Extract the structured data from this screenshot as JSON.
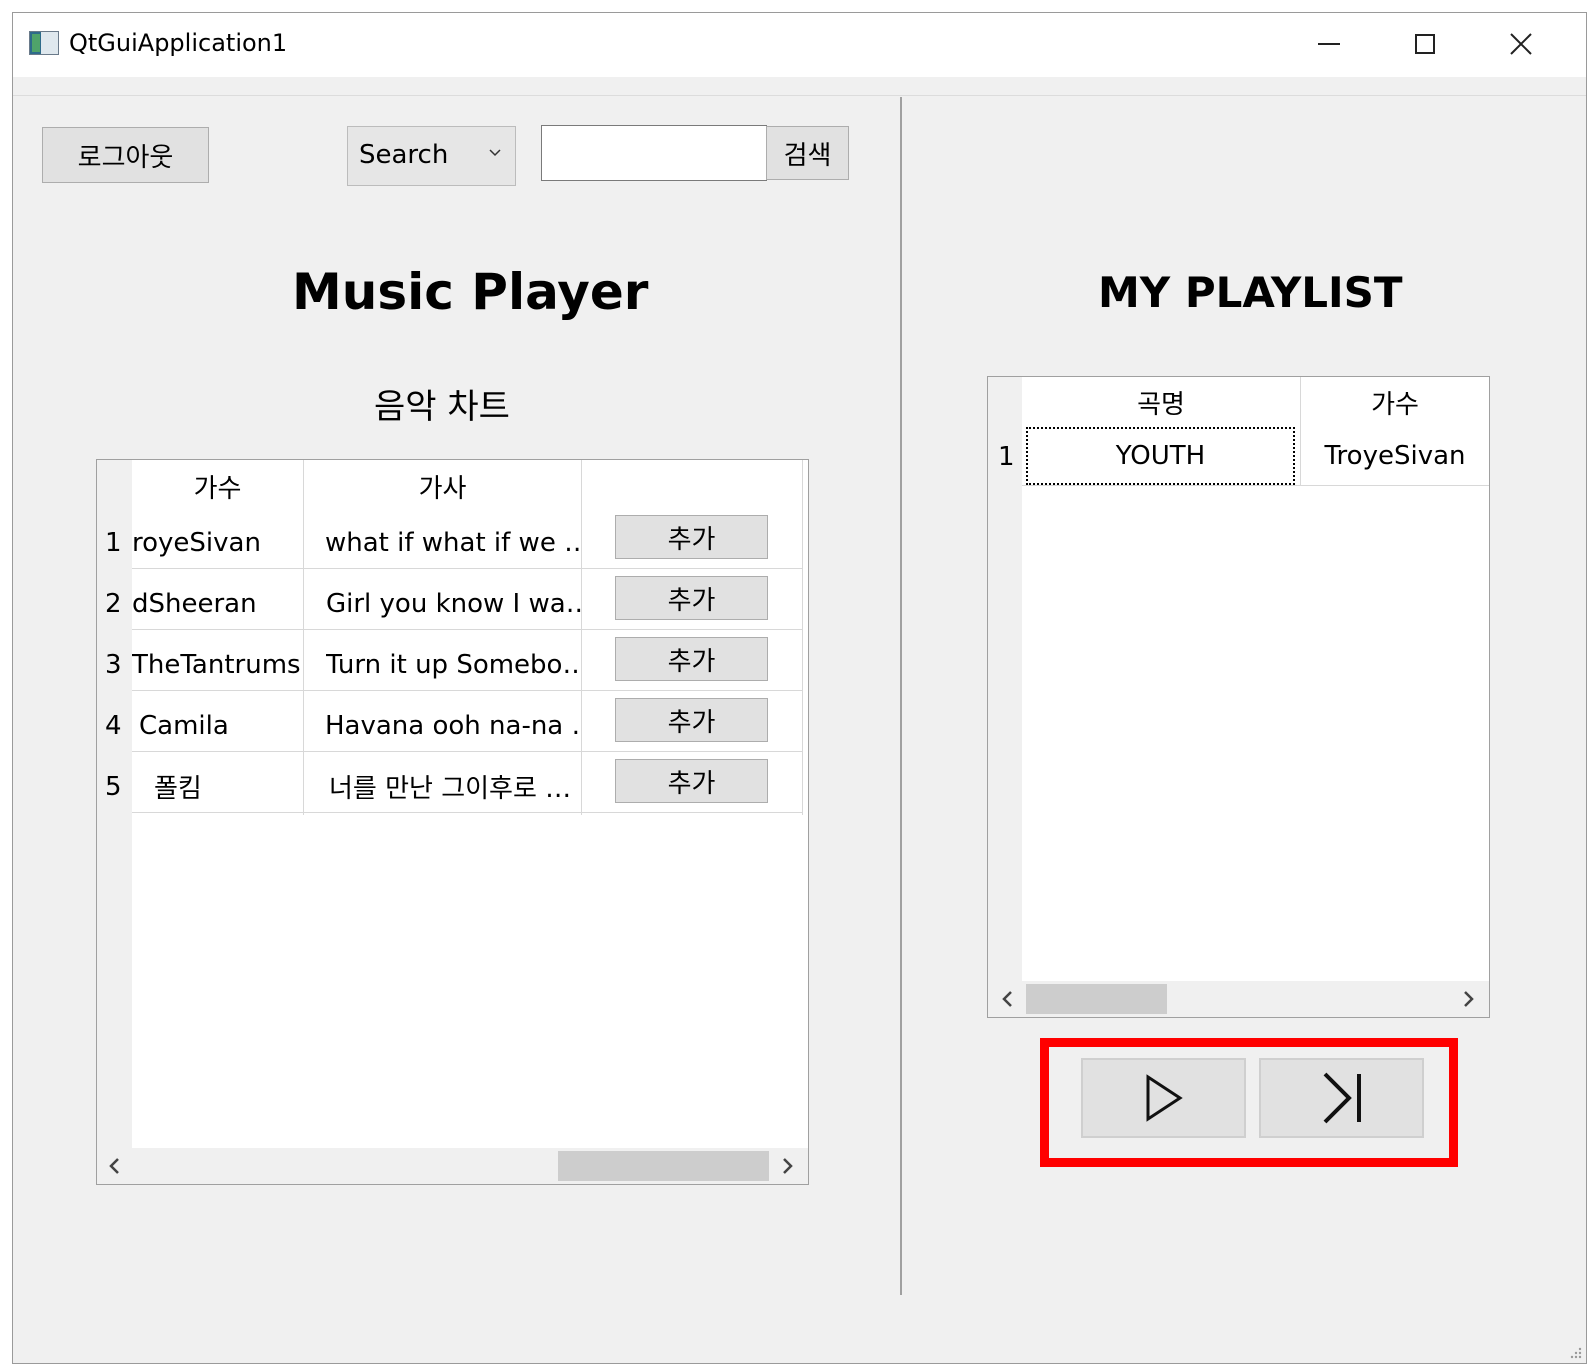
{
  "window": {
    "title": "QtGuiApplication1",
    "controls": {
      "minimize": "minimize-icon",
      "maximize": "maximize-icon",
      "close": "close-icon"
    }
  },
  "left": {
    "logout_label": "로그아웃",
    "search_combo": {
      "selected": "Search"
    },
    "search_input": {
      "value": ""
    },
    "search_button_label": "검색",
    "title": "Music Player",
    "chart_title": "음악 차트",
    "chart_table": {
      "headers": [
        "가수",
        "가사",
        ""
      ],
      "rows": [
        {
          "index": "1",
          "artist": "royeSivan",
          "lyrics": "what if what if we …",
          "action": "추가"
        },
        {
          "index": "2",
          "artist": "dSheeran",
          "lyrics": "Girl you know I wa…",
          "action": "추가"
        },
        {
          "index": "3",
          "artist": "TheTantrums",
          "lyrics": "Turn it up Somebo…",
          "action": "추가"
        },
        {
          "index": "4",
          "artist": "Camila",
          "lyrics": "Havana ooh na-na …",
          "action": "추가"
        },
        {
          "index": "5",
          "artist": "폴킴",
          "lyrics": "너를 만난 그이후로 …",
          "action": "추가"
        }
      ]
    }
  },
  "right": {
    "title": "MY PLAYLIST",
    "playlist_table": {
      "headers": [
        "곡명",
        "가수"
      ],
      "rows": [
        {
          "index": "1",
          "song": "YOUTH",
          "artist": "TroyeSivan"
        }
      ]
    },
    "controls": {
      "play": "play-icon",
      "next": "skip-next-icon"
    }
  },
  "colors": {
    "highlight": "#ff0000",
    "window_bg": "#f0f0f0",
    "button_bg": "#e1e1e1"
  }
}
